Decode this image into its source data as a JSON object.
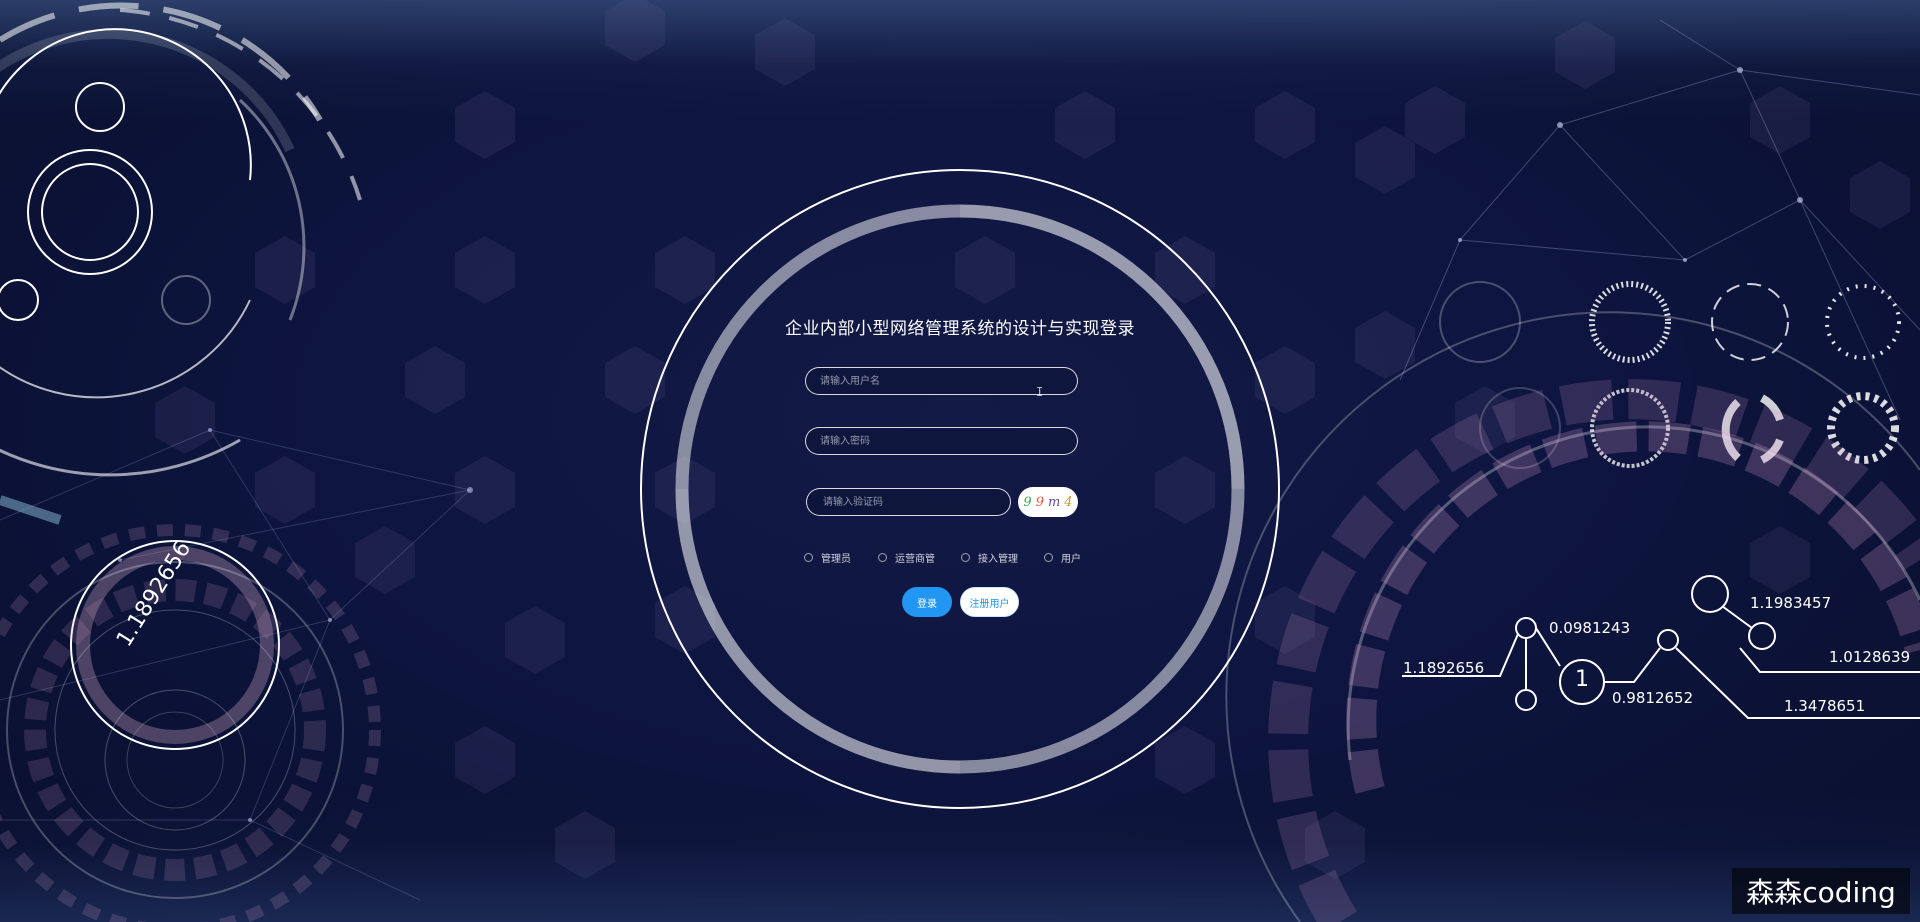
{
  "login": {
    "title": "企业内部小型网络管理系统的设计与实现登录",
    "username_placeholder": "请输入用户名",
    "password_placeholder": "请输入密码",
    "captcha_placeholder": "请输入验证码",
    "captcha_chars": [
      "9",
      "9",
      "m",
      "4"
    ],
    "roles": [
      "管理员",
      "运营商管",
      "接入管理",
      "用户"
    ],
    "login_button": "登录",
    "register_button": "注册用户"
  },
  "decor": {
    "rotated_number": "1.1892656",
    "node_label": "1",
    "numbers": [
      "0.0981243",
      "1.1983457",
      "1.1892656",
      "1.0128639",
      "0.9812652",
      "1.3478651"
    ]
  },
  "watermark": "森森coding",
  "colors": {
    "background": "#0c1438",
    "accent": "#2196f3",
    "ring": "#ffffff"
  }
}
